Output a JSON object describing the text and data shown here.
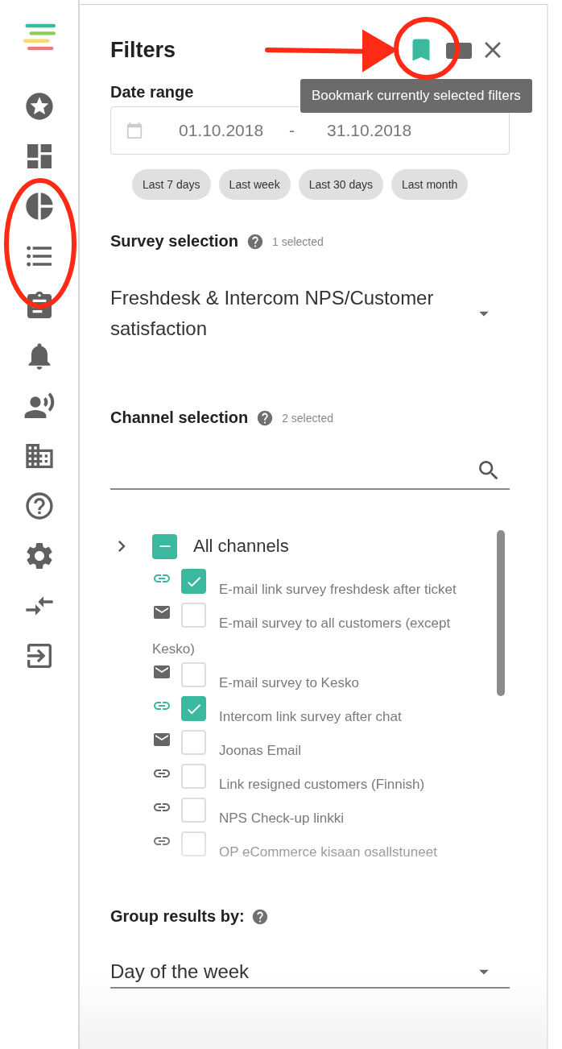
{
  "sidebar": {
    "items": [
      {
        "kind": "logo"
      },
      {
        "kind": "star"
      },
      {
        "kind": "dashboard"
      },
      {
        "kind": "pie"
      },
      {
        "kind": "list"
      },
      {
        "kind": "clipboard"
      },
      {
        "kind": "bell"
      },
      {
        "kind": "voice"
      },
      {
        "kind": "building"
      },
      {
        "kind": "help"
      },
      {
        "kind": "settings"
      },
      {
        "kind": "merge"
      },
      {
        "kind": "exit"
      }
    ]
  },
  "header": {
    "title": "Filters",
    "actions": [
      {
        "kind": "bookmark",
        "highlighted": true
      },
      {
        "kind": "folder",
        "highlighted": false
      },
      {
        "kind": "close",
        "highlighted": false
      }
    ],
    "tooltip": "Bookmark currently selected filters"
  },
  "date_range": {
    "label": "Date range",
    "from": "01.10.2018",
    "separator": "-",
    "to": "31.10.2018",
    "presets": [
      "Last 7 days",
      "Last week",
      "Last 30 days",
      "Last month"
    ]
  },
  "survey_selection": {
    "label": "Survey selection",
    "count": "1 selected",
    "value": "Freshdesk & Intercom NPS/Customer satisfaction"
  },
  "channel_selection": {
    "label": "Channel selection",
    "count": "2 selected",
    "all": {
      "label": "All channels",
      "expanded": false,
      "indeterminate": true
    },
    "channels": [
      {
        "kind": "link",
        "checked": true,
        "label": "E-mail link survey freshdesk after ticket"
      },
      {
        "kind": "email",
        "checked": false,
        "label": "E-mail survey to all customers (except Kesko)"
      },
      {
        "kind": "email",
        "checked": false,
        "label": "E-mail survey to Kesko"
      },
      {
        "kind": "link",
        "checked": true,
        "label": "Intercom link survey after chat"
      },
      {
        "kind": "email",
        "checked": false,
        "label": "Joonas Email"
      },
      {
        "kind": "link",
        "checked": false,
        "label": "Link resigned customers (Finnish)"
      },
      {
        "kind": "link",
        "checked": false,
        "label": "NPS Check-up linkki"
      },
      {
        "kind": "link",
        "checked": false,
        "label": "OP eCommerce kisaan osallstuneet"
      }
    ]
  },
  "group_by": {
    "label": "Group results by:",
    "value": "Day of the week"
  },
  "annotations": [
    {
      "kind": "arrow"
    },
    {
      "kind": "circle-header"
    },
    {
      "kind": "circle-sidebar"
    }
  ]
}
